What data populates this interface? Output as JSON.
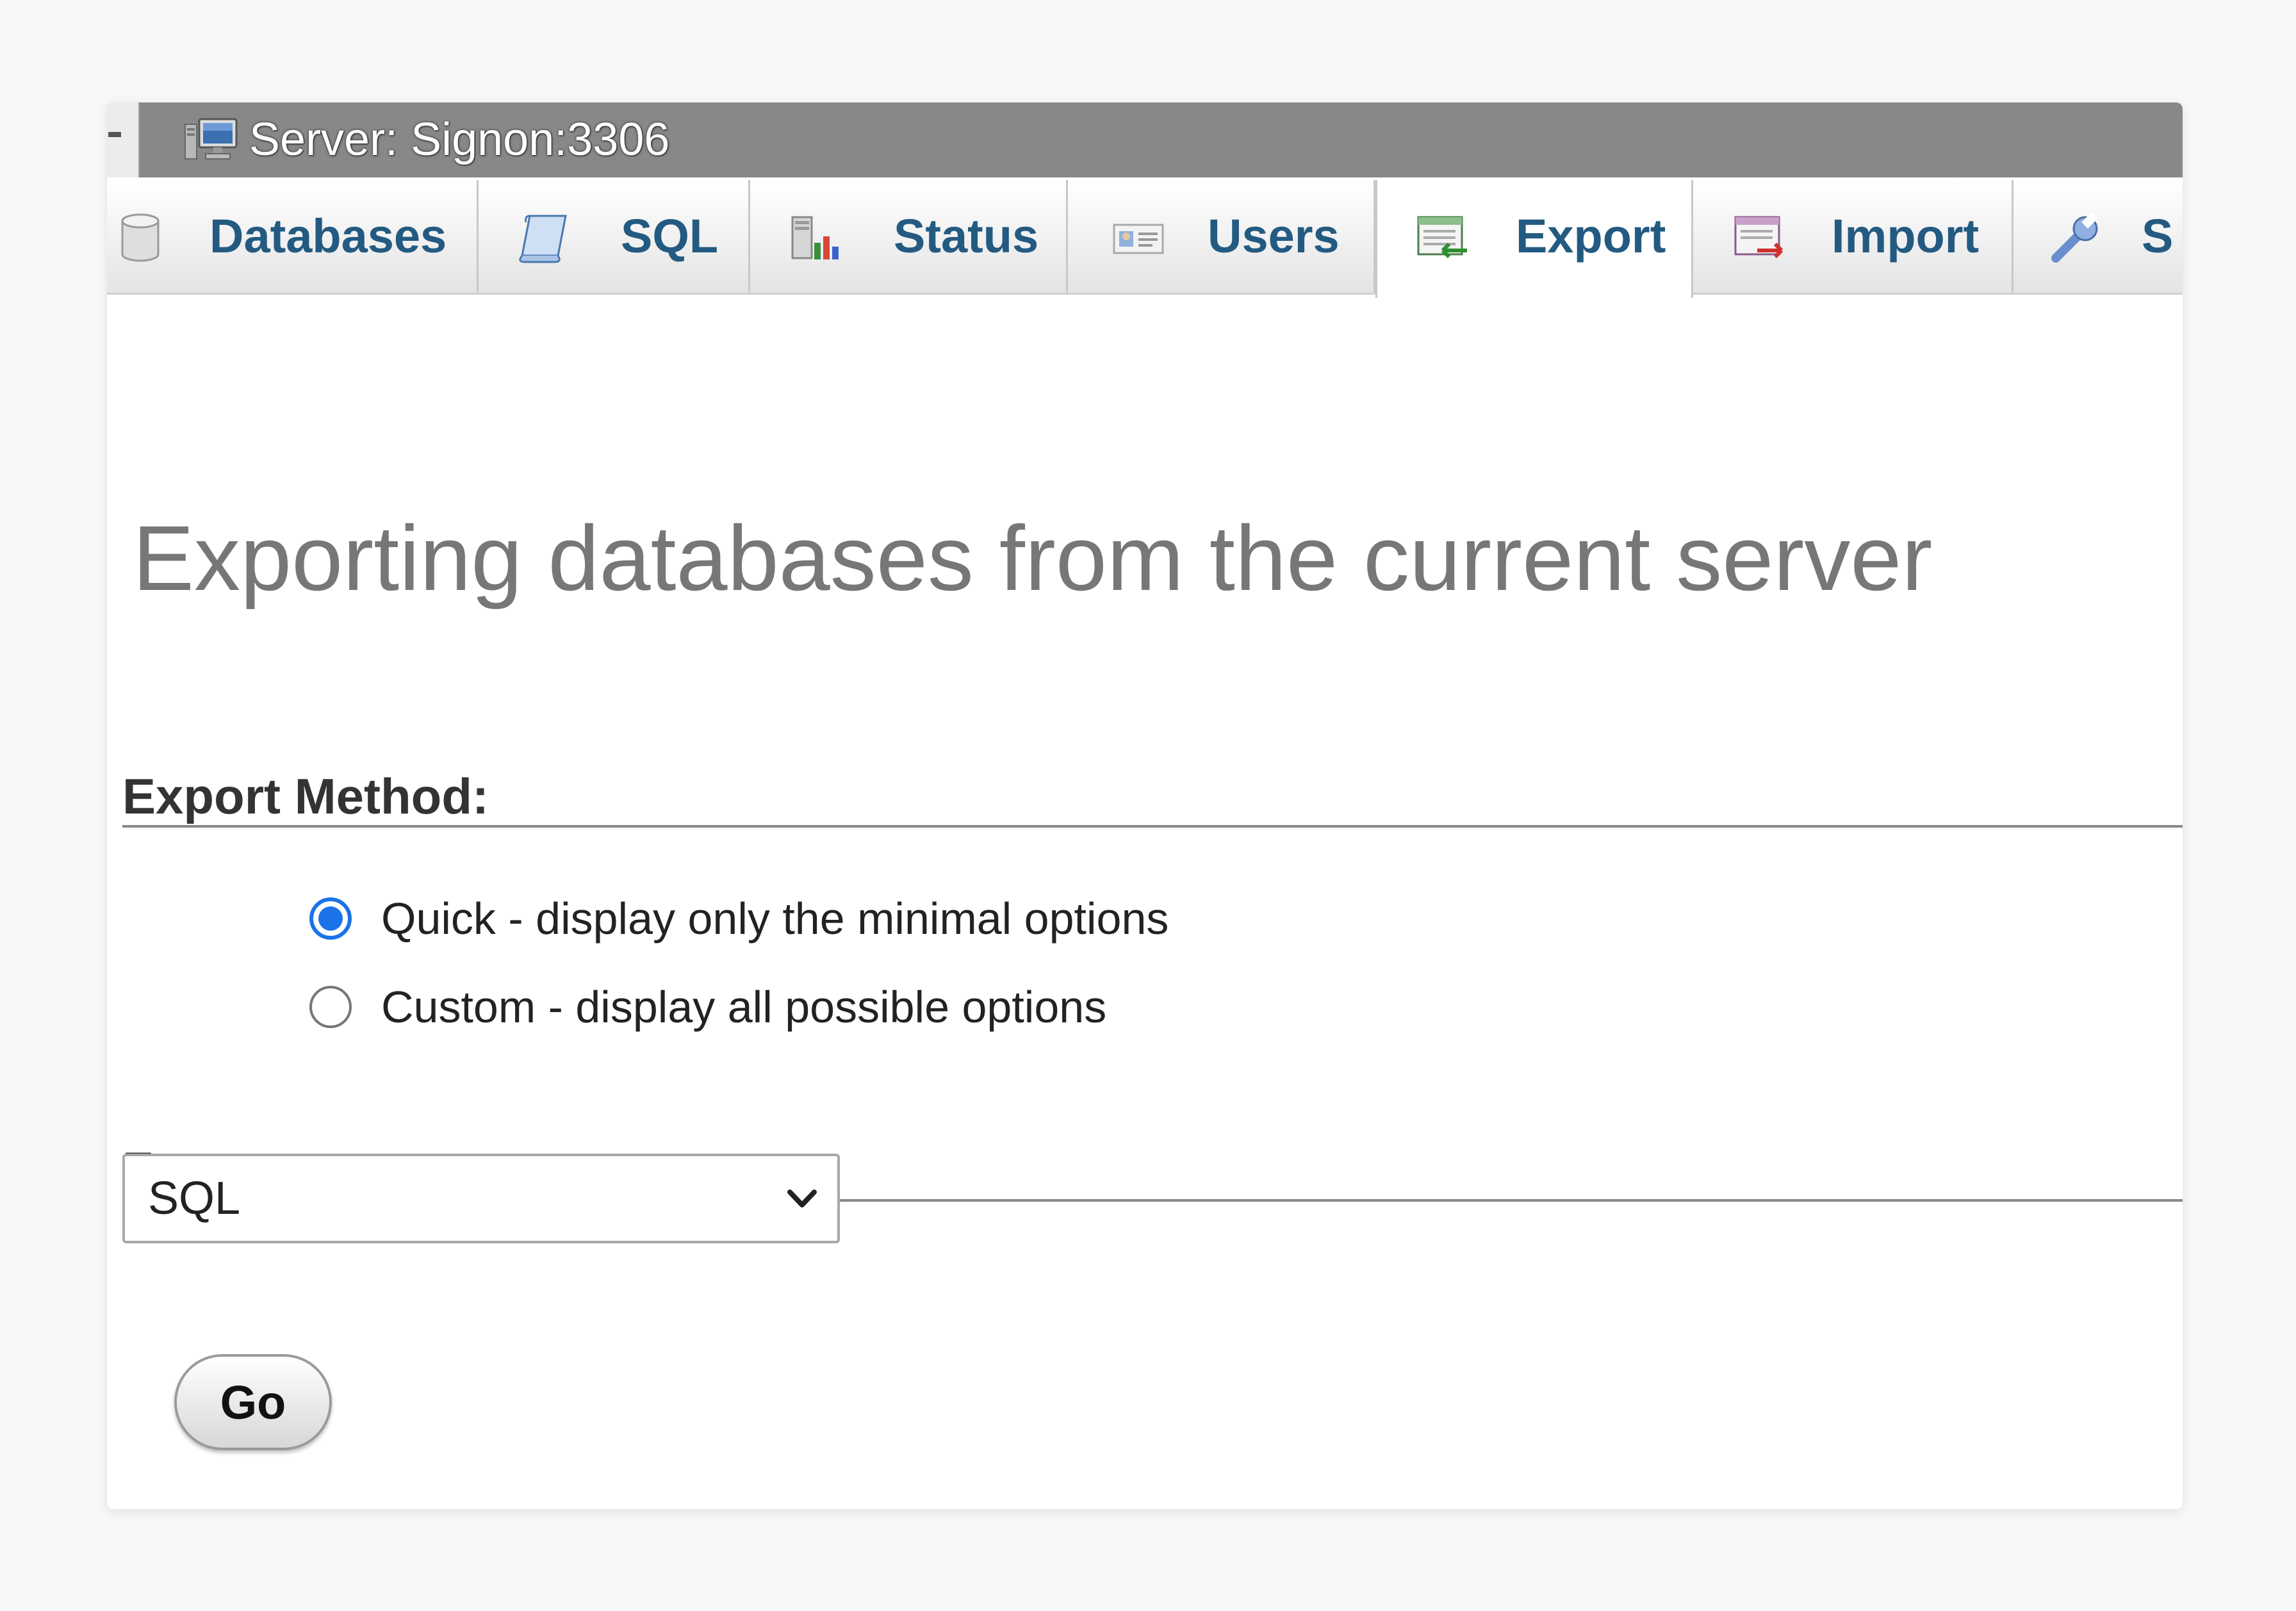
{
  "server": {
    "title": "Server: Signon:3306",
    "icon": "server-monitor-icon"
  },
  "tabs": [
    {
      "label": "Databases",
      "icon": "database-icon",
      "active": false
    },
    {
      "label": "SQL",
      "icon": "sql-scroll-icon",
      "active": false
    },
    {
      "label": "Status",
      "icon": "status-chart-icon",
      "active": false
    },
    {
      "label": "Users",
      "icon": "users-card-icon",
      "active": false
    },
    {
      "label": "Export",
      "icon": "export-icon",
      "active": true
    },
    {
      "label": "Import",
      "icon": "import-icon",
      "active": false
    },
    {
      "label": "S",
      "icon": "wrench-icon",
      "active": false
    }
  ],
  "page": {
    "title": "Exporting databases from the current server"
  },
  "export_method": {
    "heading": "Export Method:",
    "options": [
      {
        "label": "Quick - display only the minimal options",
        "checked": true
      },
      {
        "label": "Custom - display all possible options",
        "checked": false
      }
    ]
  },
  "format": {
    "heading": "Format:",
    "selected": "SQL"
  },
  "actions": {
    "go_label": "Go"
  },
  "colors": {
    "server_bar": "#888888",
    "tab_label": "#235a81",
    "radio_accent": "#1a73e8",
    "title_gray": "#777777"
  }
}
